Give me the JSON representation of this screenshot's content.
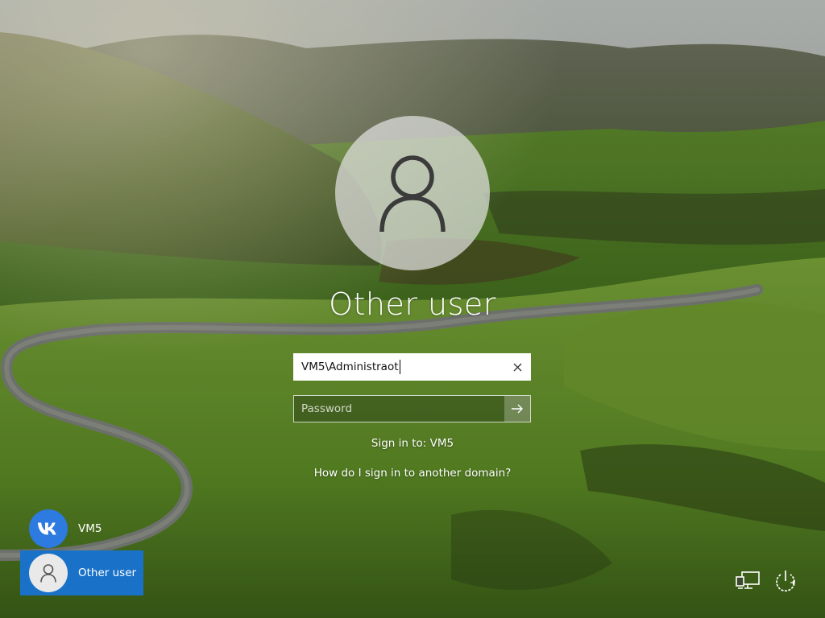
{
  "login": {
    "title": "Other user",
    "username_value": "VM5\\Administraot",
    "password_placeholder": "Password",
    "sign_in_to": "Sign in to: VM5",
    "help_link": "How do I sign in to another domain?"
  },
  "users": [
    {
      "label": "VM5",
      "icon": "vk-logo-icon",
      "selected": false
    },
    {
      "label": "Other user",
      "icon": "user-icon",
      "selected": true
    }
  ],
  "corner_icons": [
    "network-icon",
    "power-icon"
  ],
  "colors": {
    "selected_user_bg": "#1a72c8",
    "vk_logo_bg": "#2d7ae0",
    "avatar_bg": "#e1e1e1"
  }
}
